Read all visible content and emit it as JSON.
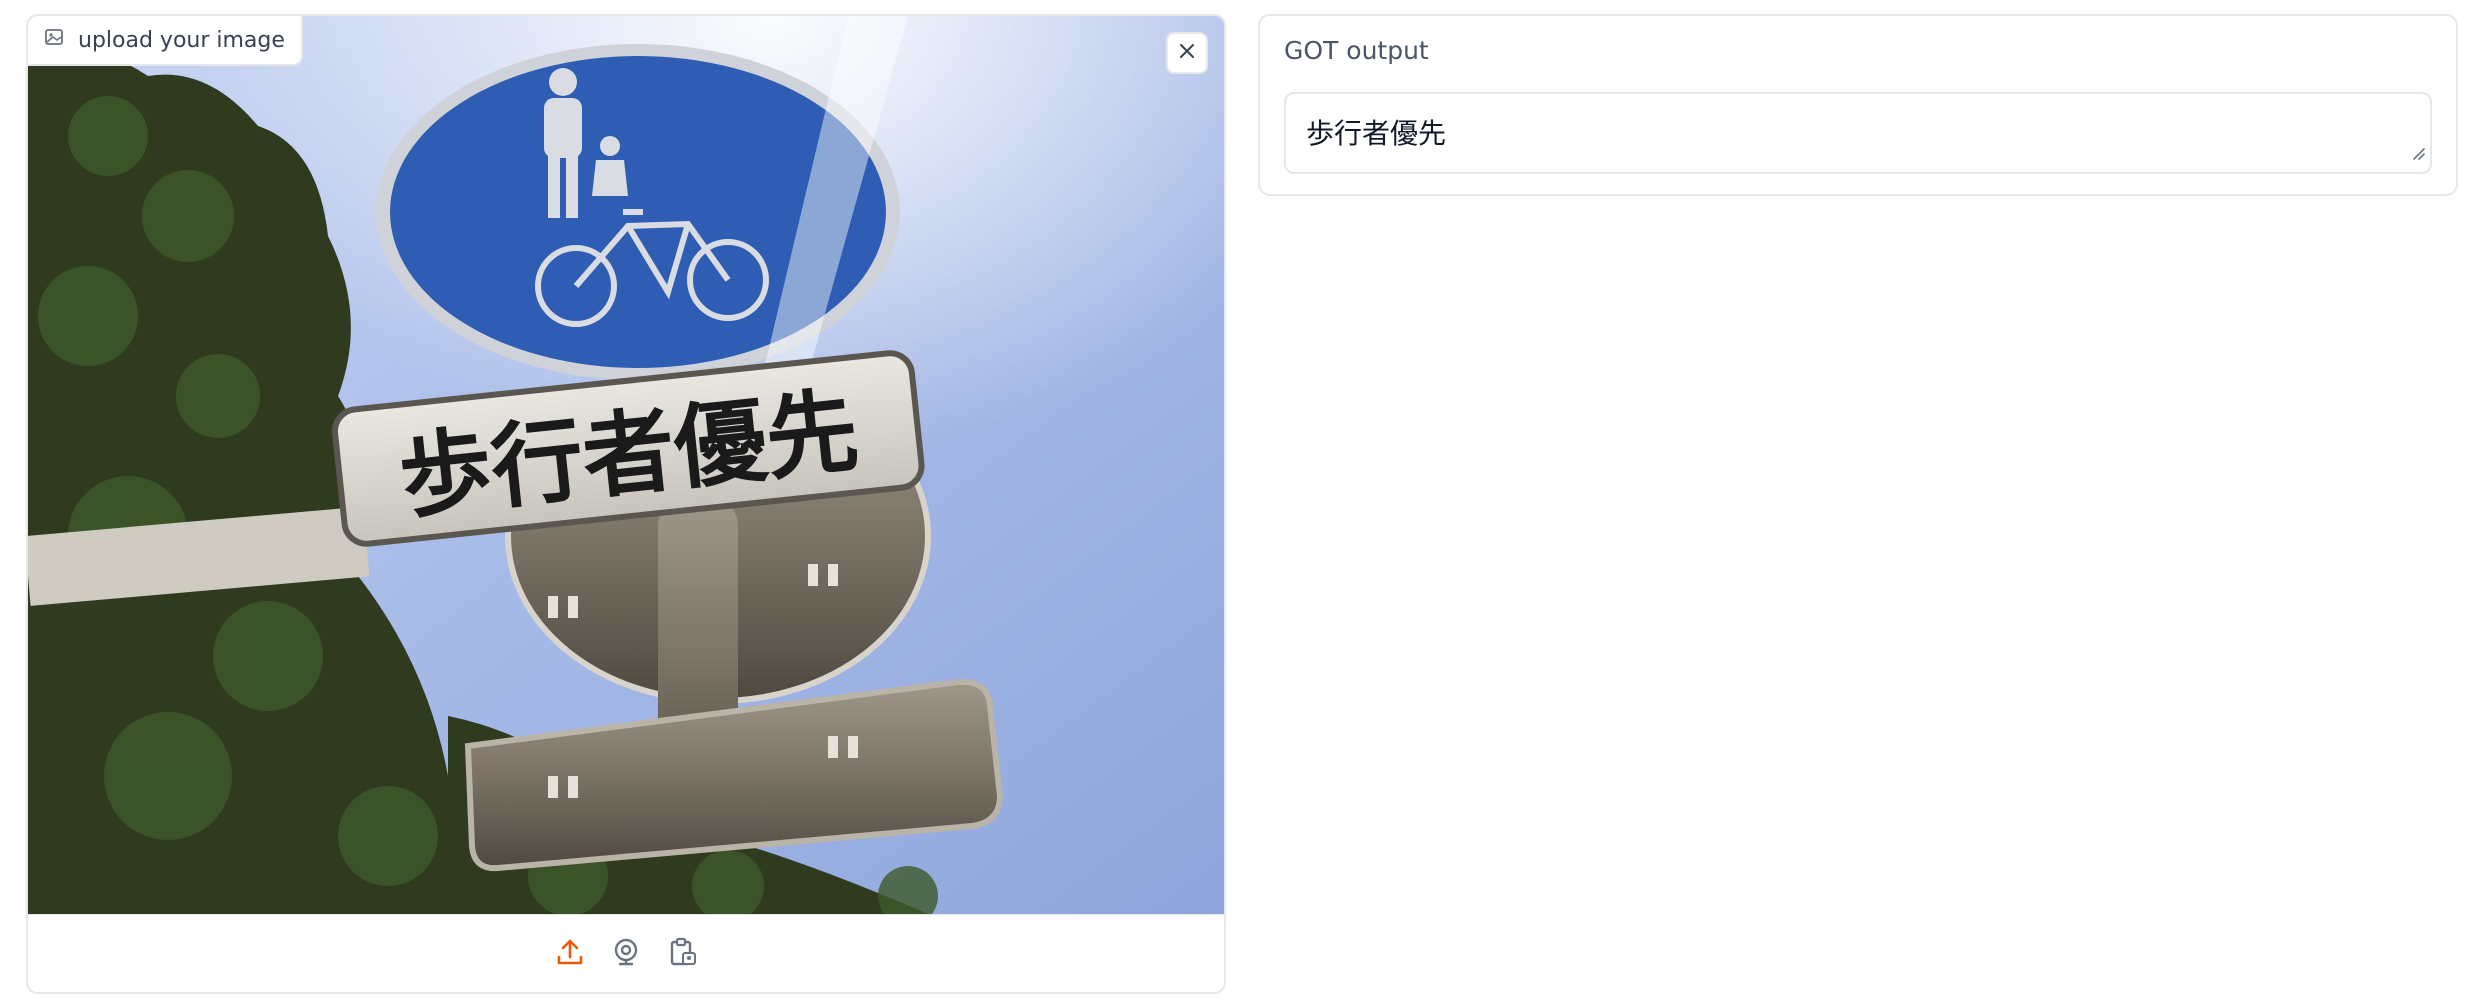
{
  "image_input": {
    "label": "upload your image",
    "label_icon": "image-icon",
    "clear_icon": "close-icon",
    "photo": {
      "description_icon": "photo",
      "sign_text": "歩行者優先"
    },
    "toolbar": [
      {
        "icon": "upload-icon",
        "color": "#ea580c"
      },
      {
        "icon": "webcam-icon",
        "color": "#6b7280"
      },
      {
        "icon": "clipboard-icon",
        "color": "#6b7280"
      }
    ]
  },
  "output": {
    "label": "GOT output",
    "value": "歩行者優先"
  },
  "colors": {
    "accent": "#ea580c",
    "border": "#e5e7eb",
    "sky": "#a9bce8",
    "sign_blue": "#2f5db3"
  }
}
